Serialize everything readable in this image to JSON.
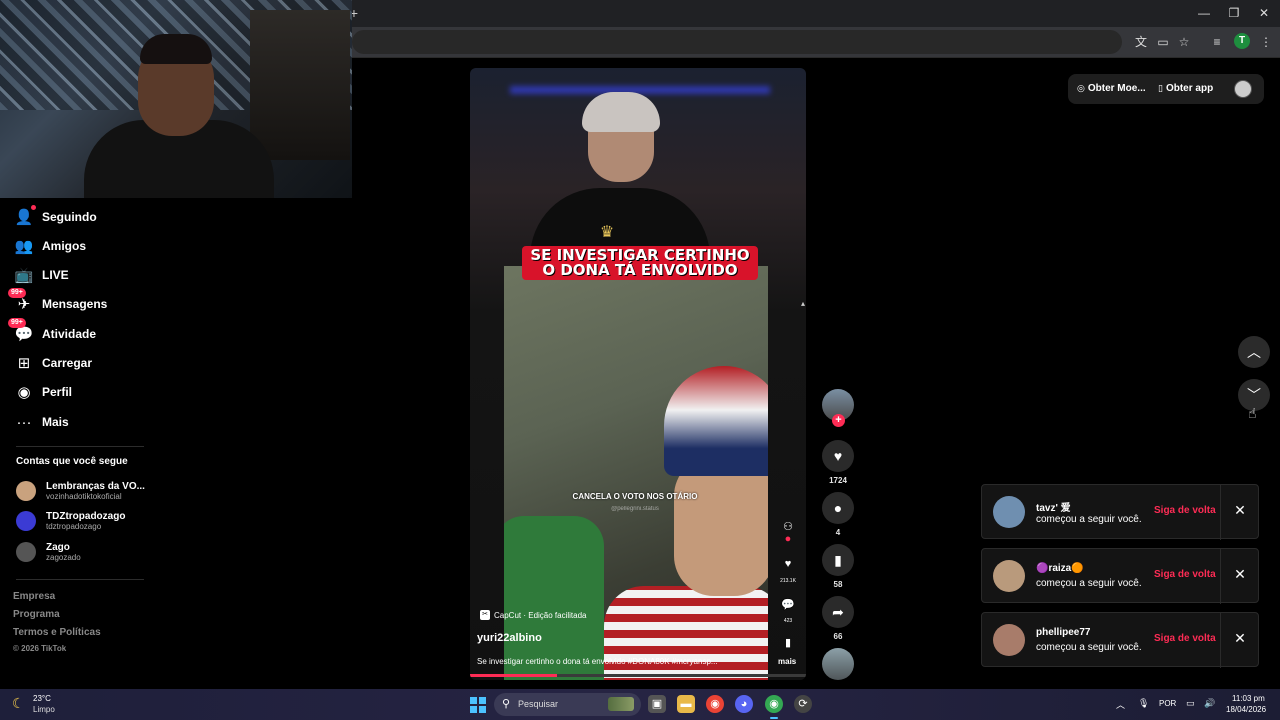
{
  "browser": {
    "new_tab_glyph": "+",
    "window_controls": [
      "—",
      "❐",
      "✕"
    ],
    "profile_initial": "T",
    "toolbar_icons": [
      "translate-icon",
      "cast-icon",
      "bookmark-star-icon",
      "media-control-icon",
      "profile-icon",
      "menu-dots-icon"
    ]
  },
  "sidebar": {
    "items": [
      {
        "label": "Seguindo",
        "icon": "following-icon",
        "glyph": "👤",
        "badge": "",
        "dot": true
      },
      {
        "label": "Amigos",
        "icon": "friends-icon",
        "glyph": "👥",
        "badge": "",
        "dot": false
      },
      {
        "label": "LIVE",
        "icon": "live-icon",
        "glyph": "📺",
        "badge": "",
        "dot": false
      },
      {
        "label": "Mensagens",
        "icon": "messages-icon",
        "glyph": "✈",
        "badge": "99+",
        "dot": false
      },
      {
        "label": "Atividade",
        "icon": "activity-icon",
        "glyph": "💬",
        "badge": "99+",
        "dot": false
      },
      {
        "label": "Carregar",
        "icon": "upload-icon",
        "glyph": "⊞",
        "badge": "",
        "dot": false
      },
      {
        "label": "Perfil",
        "icon": "profile-icon",
        "glyph": "◉",
        "badge": "",
        "dot": false
      },
      {
        "label": "Mais",
        "icon": "more-icon",
        "glyph": "···",
        "badge": "",
        "dot": false
      }
    ],
    "following_title": "Contas que você segue",
    "following": [
      {
        "name": "Lembranças da VO...",
        "user": "vozinhadotiktokoficial",
        "color": "#c9a27e"
      },
      {
        "name": "TDZtropadozago",
        "user": "tdztropadozago",
        "color": "#3b3bd4"
      },
      {
        "name": "Zago",
        "user": "zagozado",
        "color": "#555555"
      }
    ],
    "footer": [
      "Empresa",
      "Programa",
      "Termos e Políticas"
    ],
    "copyright": "© 2026 TikTok"
  },
  "topbar": {
    "coins_label": "Obter Moe...",
    "app_label": "Obter app"
  },
  "video": {
    "headline": "SE INVESTIGAR CERTINHO O DONA TÁ ENVOLVIDO",
    "subcaption": "CANCELA O VOTO NOS OTÁRIO",
    "watermark": "@pellegrini.status",
    "capcut": "CapCut · Edição facilitada",
    "author": "yuri22albino",
    "description": "Se investigar certinho o dona tá envolvido #DONA80K #mcryansp...",
    "more": "mais",
    "progress": 0.26,
    "inner_likes": "213.1K",
    "inner_comments": "423"
  },
  "actions": {
    "likes": "1724",
    "comments": "4",
    "saves": "58",
    "shares": "66"
  },
  "notifications": [
    {
      "name": "tavz' 爱",
      "text": "começou a seguir você.",
      "button": "Siga de volta",
      "color": "#6f8fb0"
    },
    {
      "name": "🟣raiza🟠",
      "text": "começou a seguir você.",
      "button": "Siga de volta",
      "color": "#b99a7c"
    },
    {
      "name": "phellipee77",
      "text": "começou a seguir você.",
      "button": "Siga de volta",
      "color": "#a87c6a"
    }
  ],
  "taskbar": {
    "temp": "23°C",
    "condition": "Limpo",
    "search_placeholder": "Pesquisar",
    "lang": "POR",
    "time": "11:03 pm",
    "date": "18/04/2026"
  }
}
